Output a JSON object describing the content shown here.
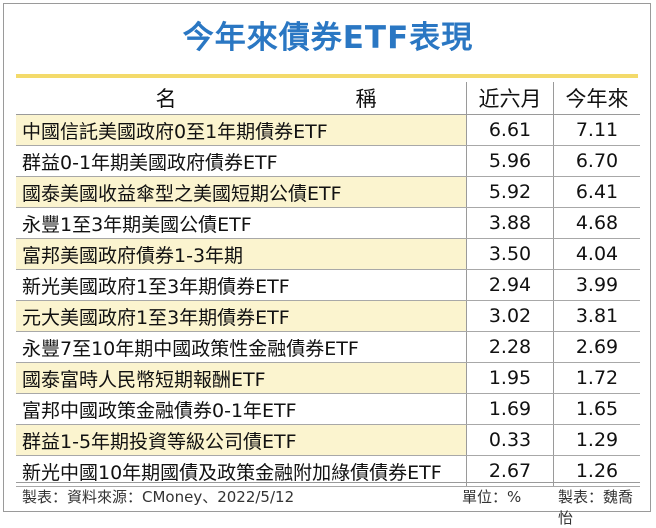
{
  "title": "今年來債券ETF表現",
  "header": {
    "name_a": "名",
    "name_b": "稱",
    "col1": "近六月",
    "col2": "今年來"
  },
  "chart_data": {
    "type": "table",
    "columns": [
      "名稱",
      "近六月",
      "今年來"
    ],
    "rows": [
      {
        "name": "中國信託美國政府0至1年期債券ETF",
        "six_month": "6.61",
        "ytd": "7.11"
      },
      {
        "name": "群益0-1年期美國政府債券ETF",
        "six_month": "5.96",
        "ytd": "6.70"
      },
      {
        "name": "國泰美國收益傘型之美國短期公債ETF",
        "six_month": "5.92",
        "ytd": "6.41"
      },
      {
        "name": "永豐1至3年期美國公債ETF",
        "six_month": "3.88",
        "ytd": "4.68"
      },
      {
        "name": "富邦美國政府債券1-3年期",
        "six_month": "3.50",
        "ytd": "4.04"
      },
      {
        "name": "新光美國政府1至3年期債券ETF",
        "six_month": "2.94",
        "ytd": "3.99"
      },
      {
        "name": "元大美國政府1至3年期債券ETF",
        "six_month": "3.02",
        "ytd": "3.81"
      },
      {
        "name": "永豐7至10年期中國政策性金融債券ETF",
        "six_month": "2.28",
        "ytd": "2.69"
      },
      {
        "name": "國泰富時人民幣短期報酬ETF",
        "six_month": "1.95",
        "ytd": "1.72"
      },
      {
        "name": "富邦中國政策金融債券0-1年ETF",
        "six_month": "1.69",
        "ytd": "1.65"
      },
      {
        "name": "群益1-5年期投資等級公司債ETF",
        "six_month": "0.33",
        "ytd": "1.29"
      },
      {
        "name": "新光中國10年期國債及政策金融附加綠債債券ETF",
        "six_month": "2.67",
        "ytd": "1.26"
      }
    ]
  },
  "footer": {
    "source": "製表：資料來源：CMoney、2022/5/12",
    "unit": "單位：%",
    "maker": "製表：魏喬怡"
  },
  "colors": {
    "title": "#2a77c3",
    "accent_line": "#f3da6a",
    "row_shade": "#fbf4cf"
  }
}
